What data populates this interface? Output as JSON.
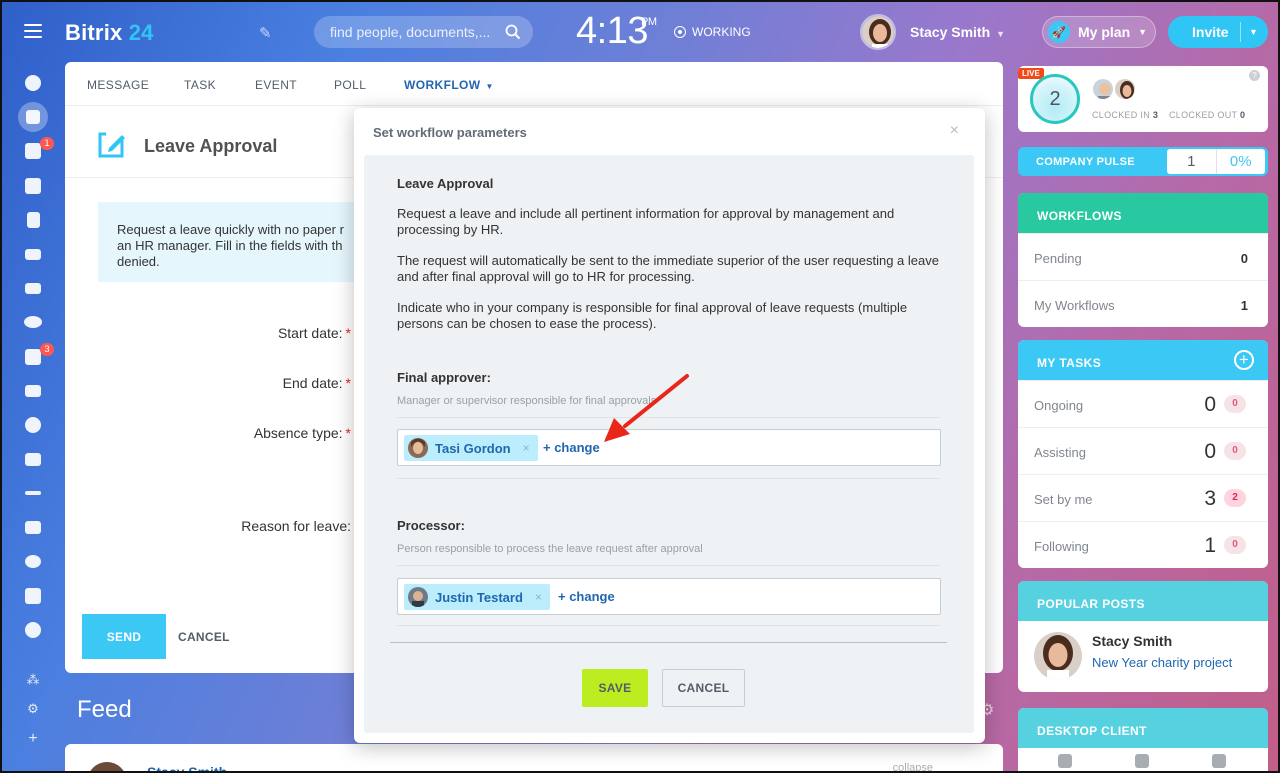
{
  "topbar": {
    "logo_main": "Bitrix",
    "logo_num": "24",
    "search_placeholder": "find people, documents,...",
    "time": "4:13",
    "ampm": "PM",
    "status": "WORKING",
    "user_name": "Stacy Smith",
    "plan_label": "My plan",
    "invite_label": "Invite"
  },
  "sidebar": {
    "badges": {
      "chat": "1",
      "tasks": "3"
    }
  },
  "tabs": [
    {
      "label": "MESSAGE"
    },
    {
      "label": "TASK"
    },
    {
      "label": "EVENT"
    },
    {
      "label": "POLL"
    },
    {
      "label": "WORKFLOW"
    }
  ],
  "form": {
    "title": "Leave Approval",
    "info_lines": [
      "Request a leave quickly with no paper r",
      "an HR manager. Fill in the fields with th",
      "denied."
    ],
    "labels": {
      "start": "Start date:",
      "end": "End date:",
      "absence": "Absence type:",
      "reason": "Reason for leave:"
    },
    "required_mark": "*",
    "send_label": "SEND",
    "cancel_label": "CANCEL"
  },
  "feed": {
    "title": "Feed",
    "author": "Stacy Smith",
    "collapse": "collapse"
  },
  "modal": {
    "title": "Set workflow parameters",
    "close": "×",
    "heading": "Leave Approval",
    "paragraphs": [
      "Request a leave and include all pertinent information for approval by management and processing by HR.",
      "The request will automatically be sent to the immediate superior of the user requesting a leave and after final approval will go to HR for processing.",
      "Indicate who in your company is responsible for final approval of leave requests (multiple persons can be chosen to ease the process)."
    ],
    "final_approver": {
      "label": "Final approver:",
      "hint": "Manager or supervisor responsible for final approvals",
      "person": "Tasi Gordon",
      "remove": "×",
      "change": "+ change"
    },
    "processor": {
      "label": "Processor:",
      "hint": "Person responsible to process the leave request after approval",
      "person": "Justin Testard",
      "remove": "×",
      "change": "+ change"
    },
    "save_label": "SAVE",
    "cancel_label": "CANCEL"
  },
  "widgets": {
    "clock": {
      "live": "LIVE",
      "count": "2",
      "clocked_in_label": "CLOCKED IN",
      "clocked_in": "3",
      "clocked_out_label": "CLOCKED OUT",
      "clocked_out": "0",
      "help": "?"
    },
    "pulse": {
      "label": "COMPANY PULSE",
      "value": "1",
      "percent": "0%"
    },
    "workflows": {
      "title": "WORKFLOWS",
      "rows": [
        {
          "label": "Pending",
          "value": "0"
        },
        {
          "label": "My Workflows",
          "value": "1"
        }
      ]
    },
    "tasks": {
      "title": "MY TASKS",
      "plus": "+",
      "rows": [
        {
          "label": "Ongoing",
          "value": "0",
          "count": "0"
        },
        {
          "label": "Assisting",
          "value": "0",
          "count": "0"
        },
        {
          "label": "Set by me",
          "value": "3",
          "count": "2"
        },
        {
          "label": "Following",
          "value": "1",
          "count": "0"
        }
      ]
    },
    "popular": {
      "title": "POPULAR POSTS",
      "author": "Stacy Smith",
      "post": "New Year charity project"
    },
    "desktop": {
      "title": "DESKTOP CLIENT"
    }
  },
  "colors": {
    "accent": "#2fc6f6",
    "link": "#2067b0",
    "save": "#bbed21",
    "workflows_head": "#28c8a0",
    "annotation_arrow": "#e8261a"
  }
}
